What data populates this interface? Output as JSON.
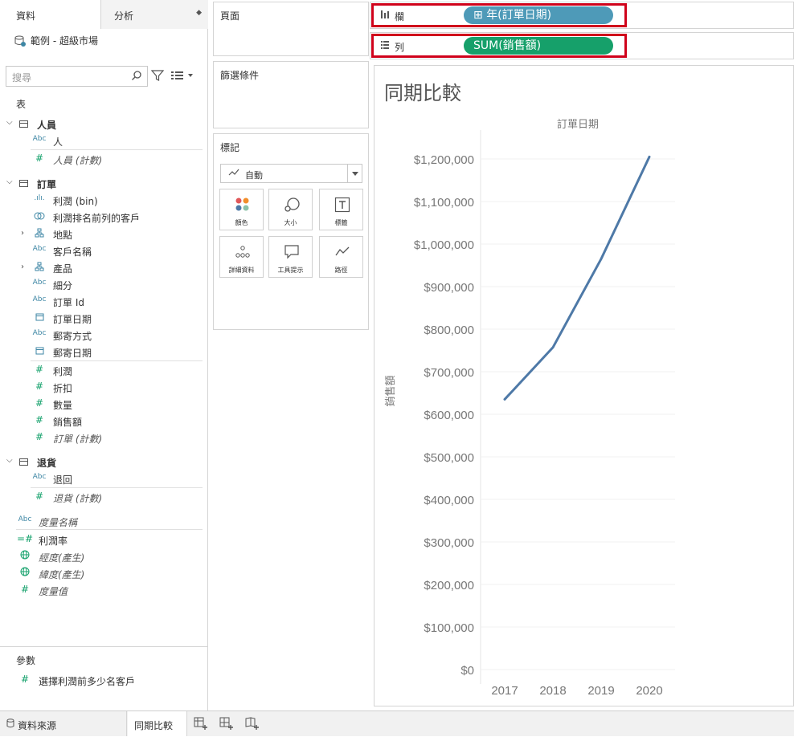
{
  "data_pane": {
    "tab_data": "資料",
    "tab_analysis": "分析",
    "datasource": "範例 - 超級市場",
    "search_placeholder": "搜尋",
    "tables_header": "表",
    "groups": [
      {
        "name": "人員",
        "fields": [
          {
            "icon": "Abc",
            "label": "人"
          },
          {
            "icon": "#",
            "label": "人員 (計數)"
          }
        ]
      },
      {
        "name": "訂單",
        "fields": [
          {
            "icon": ".ılı.",
            "label": "利潤 (bin)"
          },
          {
            "icon": "set",
            "label": "利潤排名前列的客戶"
          },
          {
            "icon": "hier",
            "label": "地點"
          },
          {
            "icon": "Abc",
            "label": "客戶名稱"
          },
          {
            "icon": "hier",
            "label": "產品"
          },
          {
            "icon": "Abc",
            "label": "細分"
          },
          {
            "icon": "Abc",
            "label": "訂單 Id"
          },
          {
            "icon": "cal",
            "label": "訂單日期"
          },
          {
            "icon": "Abc",
            "label": "郵寄方式"
          },
          {
            "icon": "cal",
            "label": "郵寄日期"
          },
          {
            "icon": "#",
            "label": "利潤"
          },
          {
            "icon": "#",
            "label": "折扣"
          },
          {
            "icon": "#",
            "label": "數量"
          },
          {
            "icon": "#",
            "label": "銷售額"
          },
          {
            "icon": "#",
            "label": "訂單 (計數)"
          }
        ]
      },
      {
        "name": "退貨",
        "fields": [
          {
            "icon": "Abc",
            "label": "退回"
          },
          {
            "icon": "#",
            "label": "退貨 (計數)"
          }
        ]
      }
    ],
    "extra_fields": [
      {
        "icon": "Abc",
        "label": "度量名稱"
      },
      {
        "icon": "=#",
        "label": "利潤率"
      },
      {
        "icon": "globe",
        "label": "經度(產生)"
      },
      {
        "icon": "globe",
        "label": "緯度(產生)"
      },
      {
        "icon": "#",
        "label": "度量值"
      }
    ],
    "params_header": "參數",
    "params": [
      {
        "icon": "#",
        "label": "選擇利潤前多少名客戶"
      }
    ]
  },
  "cards": {
    "pages": "頁面",
    "filters": "篩選條件",
    "marks": "標記",
    "mark_type": "自動",
    "mark_buttons": [
      "顏色",
      "大小",
      "標籤",
      "詳細資料",
      "工具提示",
      "路徑"
    ]
  },
  "shelves": {
    "columns_label": "欄",
    "columns_pill": "年(訂單日期)",
    "rows_label": "列",
    "rows_pill": "SUM(銷售額)",
    "columns_pill_color": "#4e9ab8",
    "rows_pill_color": "#16a06a"
  },
  "view": {
    "title": "同期比較"
  },
  "chart_data": {
    "type": "line",
    "title": "同期比較",
    "xlabel": "訂單日期",
    "ylabel": "銷售額",
    "categories": [
      "2017",
      "2018",
      "2019",
      "2020"
    ],
    "series": [
      {
        "values": [
          635000,
          757000,
          965000,
          1205000
        ]
      }
    ],
    "ylim": [
      0,
      1200000
    ],
    "yticks": [
      "$0",
      "$100,000",
      "$200,000",
      "$300,000",
      "$400,000",
      "$500,000",
      "$600,000",
      "$700,000",
      "$800,000",
      "$900,000",
      "$1,000,000",
      "$1,100,000",
      "$1,200,000"
    ],
    "line_color": "#4e79a7",
    "grid": true
  },
  "bottom_bar": {
    "datasource_tab": "資料來源",
    "sheet_tab": "同期比較"
  }
}
